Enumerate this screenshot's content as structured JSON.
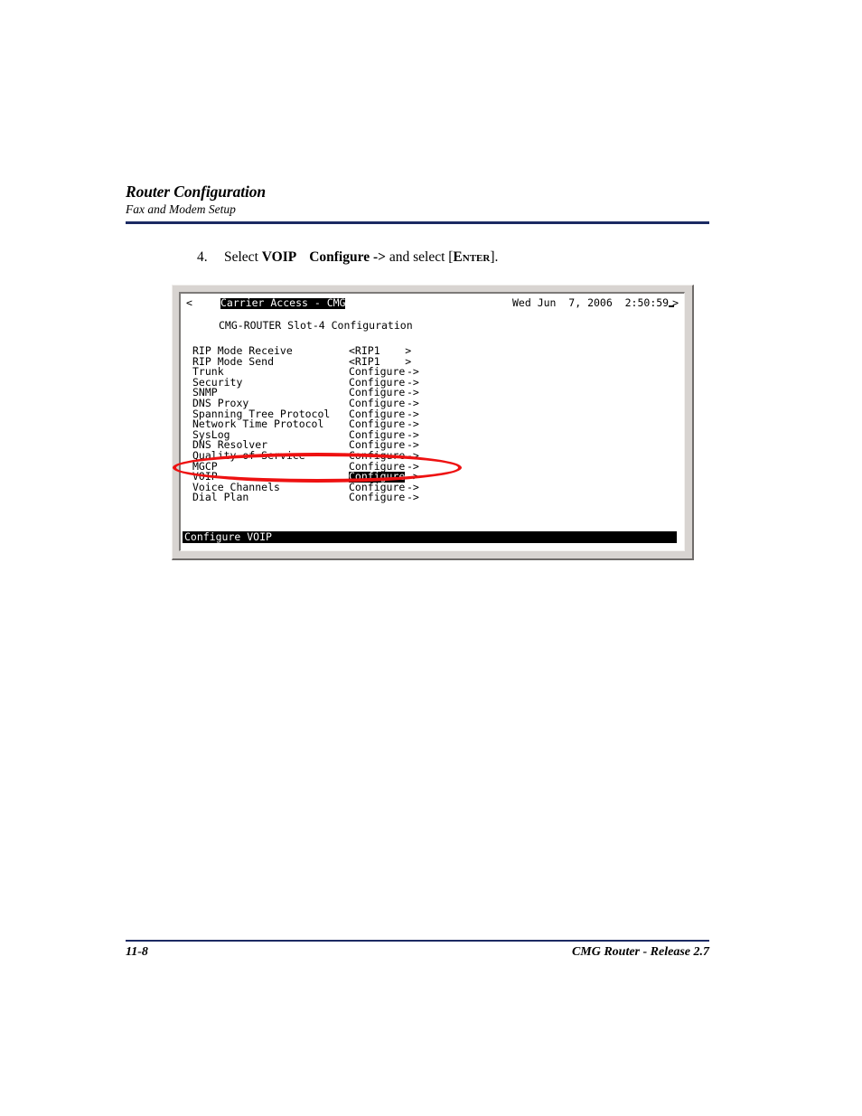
{
  "page": {
    "header_title": "Router Configuration",
    "header_subtitle": "Fax and Modem Setup",
    "footer_page_number": "11-8",
    "footer_product": "CMG Router - Release 2.7",
    "rule_color": "#1b2a63"
  },
  "step": {
    "number": "4.",
    "text_before": "Select ",
    "bold_target": "VOIP",
    "bold_action": "Configure ->",
    "text_middle": " and select [",
    "key": "Enter",
    "text_after": "]."
  },
  "terminal": {
    "titlebar": {
      "left_arrow": "<",
      "right_arrow": ">",
      "app_name": "Carrier Access - CMG",
      "clock": "Wed Jun  7, 2006  2:50:59"
    },
    "subtitle": "CMG-ROUTER Slot-4 Configuration",
    "menu_items": [
      {
        "label": "RIP Mode Receive",
        "value": "<RIP1    >",
        "arrow": "",
        "selected": false
      },
      {
        "label": "RIP Mode Send",
        "value": "<RIP1    >",
        "arrow": "",
        "selected": false
      },
      {
        "label": "Trunk",
        "value": "Configure",
        "arrow": "->",
        "selected": false
      },
      {
        "label": "Security",
        "value": "Configure",
        "arrow": "->",
        "selected": false
      },
      {
        "label": "SNMP",
        "value": "Configure",
        "arrow": "->",
        "selected": false
      },
      {
        "label": "DNS Proxy",
        "value": "Configure",
        "arrow": "->",
        "selected": false
      },
      {
        "label": "Spanning Tree Protocol",
        "value": "Configure",
        "arrow": "->",
        "selected": false
      },
      {
        "label": "Network Time Protocol",
        "value": "Configure",
        "arrow": "->",
        "selected": false
      },
      {
        "label": "SysLog",
        "value": "Configure",
        "arrow": "->",
        "selected": false
      },
      {
        "label": "DNS Resolver",
        "value": "Configure",
        "arrow": "->",
        "selected": false
      },
      {
        "label": "Quality of Service",
        "value": "Configure",
        "arrow": "->",
        "selected": false
      },
      {
        "label": "MGCP",
        "value": "Configure",
        "arrow": "->",
        "selected": false
      },
      {
        "label": "VOIP",
        "value": "Configure",
        "arrow": "->",
        "selected": true
      },
      {
        "label": "Voice Channels",
        "value": "Configure",
        "arrow": "->",
        "selected": false
      },
      {
        "label": "Dial Plan",
        "value": "Configure",
        "arrow": "->",
        "selected": false
      }
    ],
    "status_bar": "Configure VOIP",
    "annotation": {
      "shape": "ellipse",
      "color": "#ee1111",
      "encircles": "VOIP Configure -> row"
    }
  }
}
